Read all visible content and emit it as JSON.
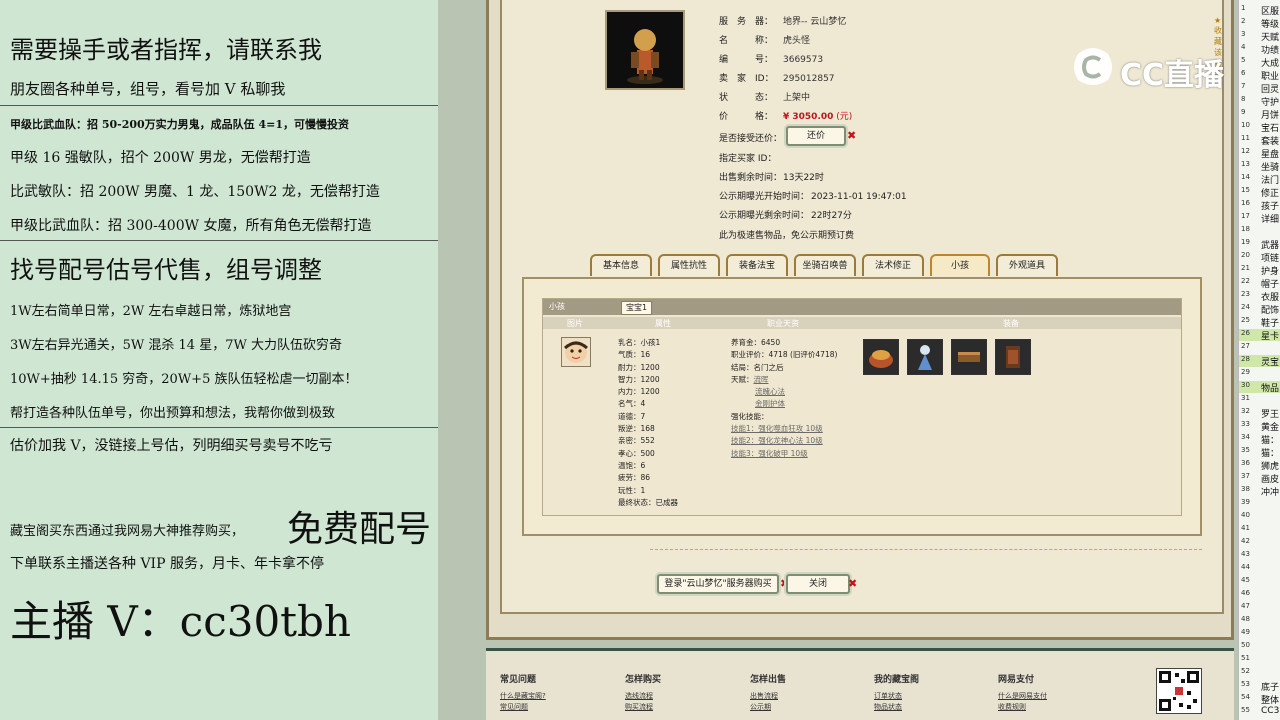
{
  "promo": {
    "lines": [
      "需要操手或者指挥，请联系我",
      "朋友圈各种单号，组号，看号加 V 私聊我",
      "甲级比武血队：招 50-200万实力男鬼，成品队伍 4=1，可慢慢投资",
      "甲级 16 强敏队，招个 200W 男龙，无偿帮打造",
      "比武敏队：招 200W 男魔、1 龙、150W2 龙，无偿帮打造",
      "甲级比武血队：招 300-400W 女魔，所有角色无偿帮打造",
      "找号配号估号代售，组号调整",
      "1W左右简单日常，2W 左右卓越日常，炼狱地宫",
      "3W左右异光通关，5W 混杀 14 星，7W 大力队伍砍穷奇",
      "10W+抽秒 14.15 穷奇，20W+5 族队伍轻松虐一切副本！",
      "帮打造各种队伍单号，你出预算和想法，我帮你做到极致",
      "估价加我 V，没链接上号估，列明细买号卖号不吃亏",
      "藏宝阁买东西通过我网易大神推荐购买，",
      "免费配号",
      "下单联系主播送各种 VIP 服务，月卡、年卡拿不停",
      "主播 V：cc30tbh"
    ]
  },
  "logo": {
    "text": "CC直播"
  },
  "listing": {
    "fav_link": "收藏该物品",
    "fields": [
      {
        "label": "服　务　器：",
        "value": "地界-- 云山梦忆"
      },
      {
        "label": "名　　　称：",
        "value": "虎头怪"
      },
      {
        "label": "编　　　号：",
        "value": "3669573"
      },
      {
        "label": "卖　家　ID：",
        "value": "295012857"
      },
      {
        "label": "状　　　态：",
        "value": "上架中"
      },
      {
        "label": "价　　　格：",
        "value": "¥ 3050.00",
        "unit": "(元)"
      }
    ],
    "bargain_label": "是否接受还价：",
    "bargain_button": "还价",
    "details": [
      {
        "label": "指定买家 ID：",
        "value": ""
      },
      {
        "label": "出售剩余时间：",
        "value": "13天22时"
      },
      {
        "label": "公示期曝光开始时间：",
        "value": "2023-11-01 19:47:01"
      },
      {
        "label": "公示期曝光剩余时间：",
        "value": "22时27分"
      }
    ],
    "note": "此为极速售物品，免公示期预订费"
  },
  "tabs": [
    "基本信息",
    "属性抗性",
    "装备法宝",
    "坐骑召唤兽",
    "法术修正",
    "小孩",
    "外观道具"
  ],
  "child_panel": {
    "title": "小孩",
    "subtab": "宝宝1",
    "columns": [
      "图片",
      "属性",
      "职业天资",
      "装备"
    ],
    "attrs": [
      "乳名：小孩1",
      "气质：16",
      "耐力：1200",
      "智力：1200",
      "内力：1200",
      "名气：4",
      "道德：7",
      "叛逆：168",
      "亲密：552",
      "孝心：500",
      "温饱：6",
      "疲劳：86",
      "玩性：1",
      "最终状态：已成器"
    ],
    "growth": [
      "养育金：6450",
      "职业评价：4718 (旧评价4718)",
      "结局：名门之后",
      "天赋："
    ],
    "talents": [
      "流晖",
      "流魄心法",
      "金刚护体"
    ],
    "skills_label": "强化技能：",
    "skills": [
      "技能1：强化噬血狂攻 10级",
      "技能2：强化龙神心法 10级",
      "技能3：强化破甲 10级"
    ]
  },
  "actions": {
    "login_button": "登录\"云山梦忆\"服务器购买",
    "close_button": "关闭"
  },
  "footer": {
    "cols": [
      {
        "head": "常见问题",
        "links": [
          "什么是藏宝阁?",
          "常见问题"
        ]
      },
      {
        "head": "怎样购买",
        "links": [
          "选线流程",
          "购买流程"
        ]
      },
      {
        "head": "怎样出售",
        "links": [
          "出售流程",
          "公示期"
        ]
      },
      {
        "head": "我的藏宝阁",
        "links": [
          "订单状态",
          "物品状态"
        ]
      },
      {
        "head": "网易支付",
        "links": [
          "什么是网易支付",
          "收费规则"
        ]
      }
    ]
  },
  "strip": {
    "rows": [
      {
        "n": "1",
        "t": "区服",
        "hl": false
      },
      {
        "n": "2",
        "t": "等级",
        "hl": false
      },
      {
        "n": "3",
        "t": "天赋",
        "hl": false
      },
      {
        "n": "4",
        "t": "功绩",
        "hl": false
      },
      {
        "n": "5",
        "t": "大成",
        "hl": false
      },
      {
        "n": "6",
        "t": "职业",
        "hl": false
      },
      {
        "n": "7",
        "t": "回灵",
        "hl": false
      },
      {
        "n": "8",
        "t": "守护",
        "hl": false
      },
      {
        "n": "9",
        "t": "月饼",
        "hl": false
      },
      {
        "n": "10",
        "t": "宝石",
        "hl": false
      },
      {
        "n": "11",
        "t": "套装",
        "hl": false
      },
      {
        "n": "12",
        "t": "星盘",
        "hl": false
      },
      {
        "n": "13",
        "t": "坐骑",
        "hl": false
      },
      {
        "n": "14",
        "t": "法门",
        "hl": false
      },
      {
        "n": "15",
        "t": "修正",
        "hl": false
      },
      {
        "n": "16",
        "t": "孩子",
        "hl": false
      },
      {
        "n": "17",
        "t": "详细",
        "hl": false
      },
      {
        "n": "18",
        "t": "",
        "hl": false
      },
      {
        "n": "19",
        "t": "武器",
        "hl": false
      },
      {
        "n": "20",
        "t": "项链",
        "hl": false
      },
      {
        "n": "21",
        "t": "护身",
        "hl": false
      },
      {
        "n": "22",
        "t": "帽子",
        "hl": false
      },
      {
        "n": "23",
        "t": "衣服",
        "hl": false
      },
      {
        "n": "24",
        "t": "配饰",
        "hl": false
      },
      {
        "n": "25",
        "t": "鞋子",
        "hl": false
      },
      {
        "n": "26",
        "t": "星卡",
        "hl": true
      },
      {
        "n": "27",
        "t": "",
        "hl": false
      },
      {
        "n": "28",
        "t": "灵宝",
        "hl": true
      },
      {
        "n": "29",
        "t": "",
        "hl": false
      },
      {
        "n": "30",
        "t": "物品",
        "hl": true
      },
      {
        "n": "31",
        "t": "",
        "hl": false
      },
      {
        "n": "32",
        "t": "罗王",
        "hl": false
      },
      {
        "n": "33",
        "t": "黄金",
        "hl": false
      },
      {
        "n": "34",
        "t": "猫：",
        "hl": false
      },
      {
        "n": "35",
        "t": "猫：",
        "hl": false
      },
      {
        "n": "36",
        "t": "狮虎",
        "hl": false
      },
      {
        "n": "37",
        "t": "画皮",
        "hl": false
      },
      {
        "n": "38",
        "t": "冲冲",
        "hl": false
      },
      {
        "n": "39",
        "t": "",
        "hl": false
      },
      {
        "n": "40",
        "t": "",
        "hl": false
      },
      {
        "n": "41",
        "t": "",
        "hl": false
      },
      {
        "n": "42",
        "t": "",
        "hl": false
      },
      {
        "n": "43",
        "t": "",
        "hl": false
      },
      {
        "n": "44",
        "t": "",
        "hl": false
      },
      {
        "n": "45",
        "t": "",
        "hl": false
      },
      {
        "n": "46",
        "t": "",
        "hl": false
      },
      {
        "n": "47",
        "t": "",
        "hl": false
      },
      {
        "n": "48",
        "t": "",
        "hl": false
      },
      {
        "n": "49",
        "t": "",
        "hl": false
      },
      {
        "n": "50",
        "t": "",
        "hl": false
      },
      {
        "n": "51",
        "t": "",
        "hl": false
      },
      {
        "n": "52",
        "t": "",
        "hl": false
      },
      {
        "n": "53",
        "t": "底子",
        "hl": false
      },
      {
        "n": "54",
        "t": "整体",
        "hl": false
      },
      {
        "n": "55",
        "t": "CC3",
        "hl": false
      }
    ]
  }
}
